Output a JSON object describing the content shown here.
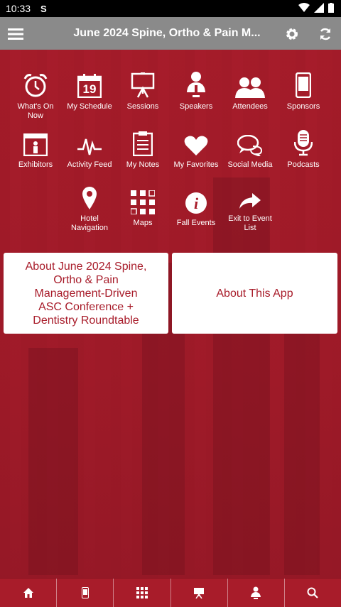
{
  "status": {
    "time": "10:33",
    "app_letter": "S"
  },
  "header": {
    "title": "June 2024 Spine, Ortho & Pain M..."
  },
  "tiles": [
    {
      "label": "What's On Now"
    },
    {
      "label": "My Schedule"
    },
    {
      "label": "Sessions"
    },
    {
      "label": "Speakers"
    },
    {
      "label": "Attendees"
    },
    {
      "label": "Sponsors"
    },
    {
      "label": "Exhibitors"
    },
    {
      "label": "Activity Feed"
    },
    {
      "label": "My Notes"
    },
    {
      "label": "My Favorites"
    },
    {
      "label": "Social Media"
    },
    {
      "label": "Podcasts"
    },
    {
      "label": "Hotel Navigation"
    },
    {
      "label": "Maps"
    },
    {
      "label": "Fall Events"
    },
    {
      "label": "Exit to Event List"
    }
  ],
  "calendar_day": "19",
  "cards": {
    "about_event": "About June 2024 Spine, Ortho & Pain Management-Driven ASC Conference + Dentistry Roundtable",
    "about_app": "About This App"
  },
  "colors": {
    "brand": "#a81c2a",
    "appbar": "#8a8a8a"
  }
}
